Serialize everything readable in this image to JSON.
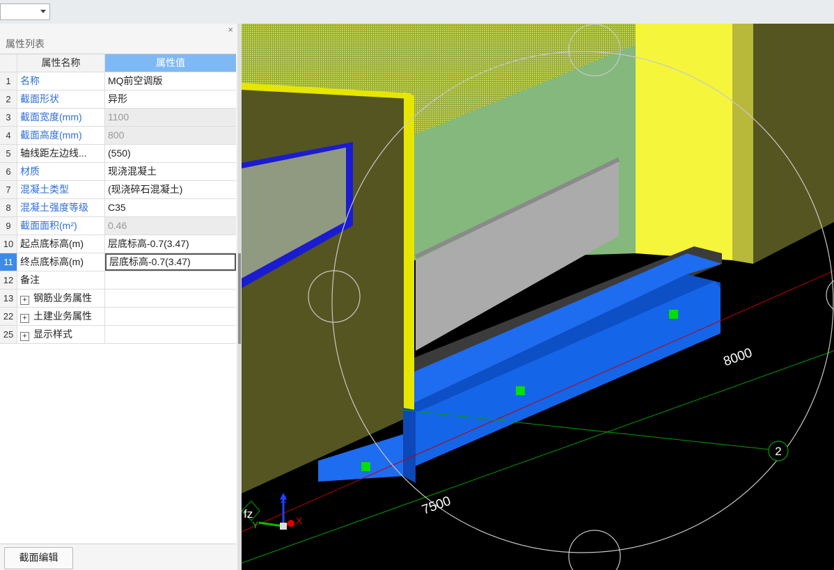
{
  "toolbar": {
    "combo_value": ""
  },
  "property_panel": {
    "title": "属性列表",
    "close_glyph": "×",
    "header": {
      "name": "属性名称",
      "value": "属性值"
    },
    "rows": [
      {
        "num": "1",
        "name": "名称",
        "value": "MQ前空调版",
        "name_blue": true,
        "readonly": false
      },
      {
        "num": "2",
        "name": "截面形状",
        "value": "异形",
        "name_blue": true,
        "readonly": false
      },
      {
        "num": "3",
        "name": "截面宽度(mm)",
        "value": "1100",
        "name_blue": true,
        "readonly": true
      },
      {
        "num": "4",
        "name": "截面高度(mm)",
        "value": "800",
        "name_blue": true,
        "readonly": true
      },
      {
        "num": "5",
        "name": "轴线距左边线...",
        "value": "(550)",
        "name_blue": false,
        "readonly": false
      },
      {
        "num": "6",
        "name": "材质",
        "value": "现浇混凝土",
        "name_blue": true,
        "readonly": false
      },
      {
        "num": "7",
        "name": "混凝土类型",
        "value": "(现浇碎石混凝土)",
        "name_blue": true,
        "readonly": false
      },
      {
        "num": "8",
        "name": "混凝土强度等级",
        "value": "C35",
        "name_blue": true,
        "readonly": false
      },
      {
        "num": "9",
        "name": "截面面积(m²)",
        "value": "0.46",
        "name_blue": true,
        "readonly": true
      },
      {
        "num": "10",
        "name": "起点底标高(m)",
        "value": "层底标高-0.7(3.47)",
        "name_blue": false,
        "readonly": false
      },
      {
        "num": "11",
        "name": "终点底标高(m)",
        "value": "层底标高-0.7(3.47)",
        "name_blue": false,
        "readonly": false,
        "selected": true
      },
      {
        "num": "12",
        "name": "备注",
        "value": "",
        "name_blue": false,
        "readonly": false
      },
      {
        "num": "13",
        "name": "钢筋业务属性",
        "value": "",
        "expandable": true,
        "expand_glyph": "+",
        "readonly": true
      },
      {
        "num": "22",
        "name": "土建业务属性",
        "value": "",
        "expandable": true,
        "expand_glyph": "+",
        "readonly": true
      },
      {
        "num": "25",
        "name": "显示样式",
        "value": "",
        "expandable": true,
        "expand_glyph": "+",
        "readonly": true
      }
    ],
    "button_label": "截面编辑"
  },
  "viewport": {
    "dimension_labels": [
      "8000",
      "7500"
    ],
    "axis_bubble": "2",
    "view_label": "fz",
    "axis_letters": {
      "z": "Z",
      "y": "Y",
      "x": "X"
    },
    "colors": {
      "background": "#000000",
      "wall": "#555522",
      "wall_edge": "#e6e600",
      "yellow_wall": "#f5f53c",
      "beam_blue": "#1565e8",
      "beam_dark": "#0d47b8",
      "grip_green": "#00e000",
      "axis_red": "#c00000",
      "axis_green": "#00a000"
    }
  }
}
